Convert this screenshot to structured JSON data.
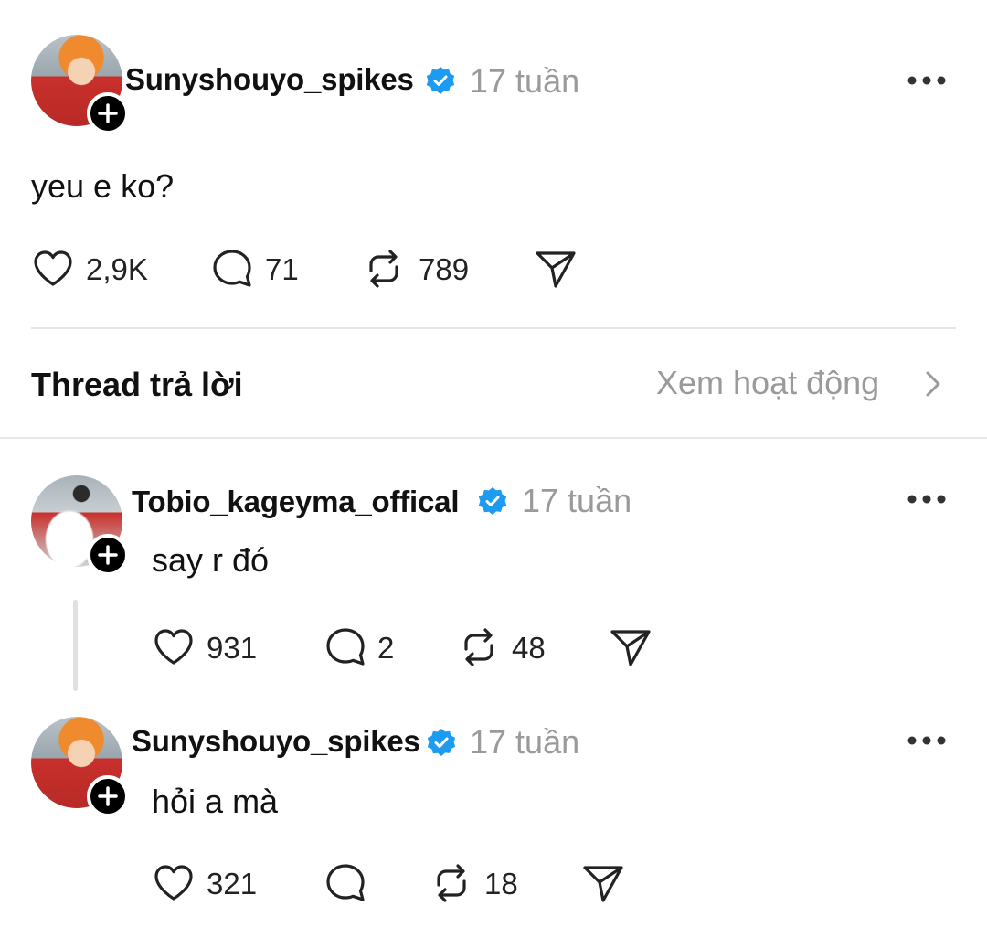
{
  "main_post": {
    "username": "Sunyshouyo_spikes",
    "time": "17 tuần",
    "text": "yeu e ko?",
    "likes": "2,9K",
    "comments": "71",
    "reposts": "789"
  },
  "replies_header": {
    "title": "Thread trả lời",
    "activity_link": "Xem hoạt động"
  },
  "replies": [
    {
      "username": "Tobio_kageyma_offical",
      "time": "17 tuần",
      "text": "say r đó",
      "likes": "931",
      "comments": "2",
      "reposts": "48"
    },
    {
      "username": "Sunyshouyo_spikes",
      "time": "17 tuần",
      "text": "hỏi a mà",
      "likes": "321",
      "comments": "",
      "reposts": "18"
    }
  ],
  "colors": {
    "verified_blue": "#1d9bf0",
    "muted_gray": "#9a9a9a",
    "divider": "#e6e6e6"
  }
}
